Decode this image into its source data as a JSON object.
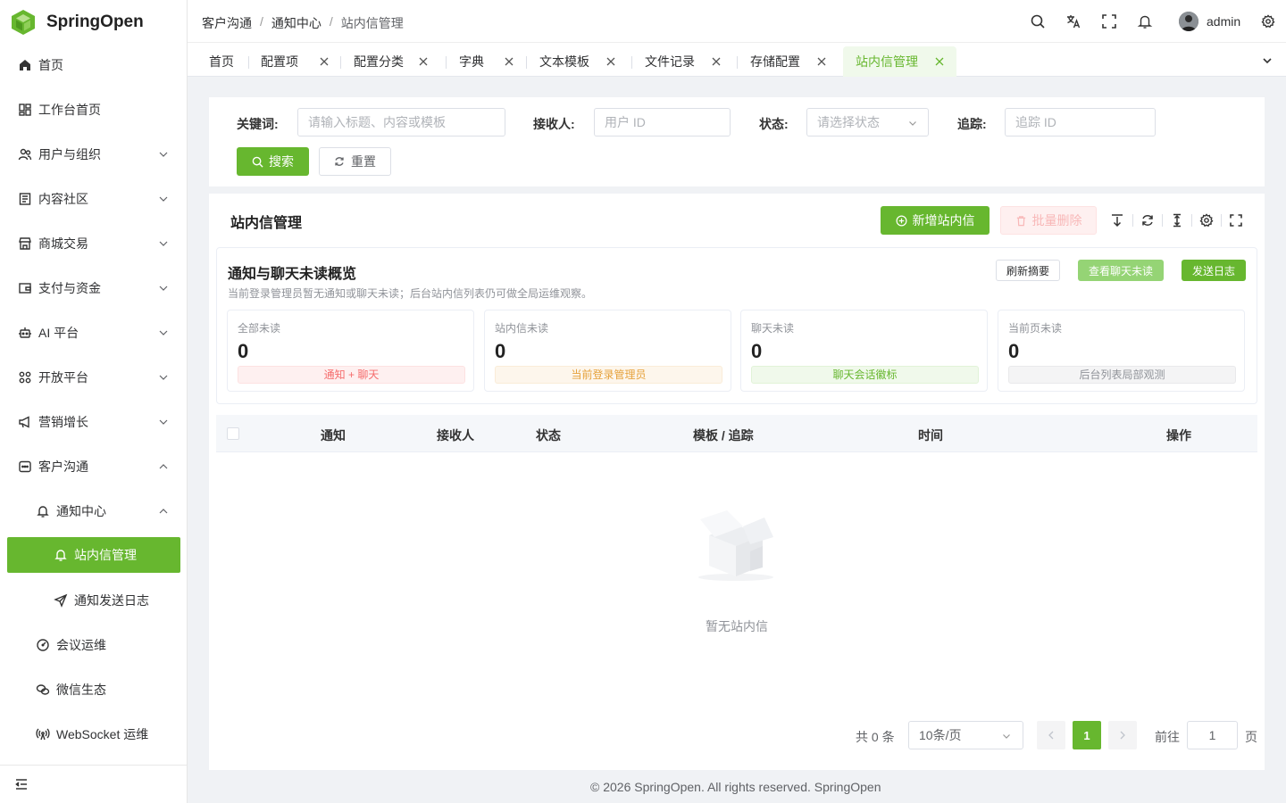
{
  "app": {
    "name": "SpringOpen"
  },
  "sidebar": {
    "items": [
      {
        "label": "首页"
      },
      {
        "label": "工作台首页"
      },
      {
        "label": "用户与组织"
      },
      {
        "label": "内容社区"
      },
      {
        "label": "商城交易"
      },
      {
        "label": "支付与资金"
      },
      {
        "label": "AI 平台"
      },
      {
        "label": "开放平台"
      },
      {
        "label": "营销增长"
      },
      {
        "label": "客户沟通"
      },
      {
        "label": "通知中心"
      },
      {
        "label": "站内信管理"
      },
      {
        "label": "通知发送日志"
      },
      {
        "label": "会议运维"
      },
      {
        "label": "微信生态"
      },
      {
        "label": "WebSocket 运维"
      }
    ]
  },
  "breadcrumb": [
    "客户沟通",
    "通知中心",
    "站内信管理"
  ],
  "header": {
    "username": "admin"
  },
  "tabs": [
    "首页",
    "配置项",
    "配置分类",
    "字典",
    "文本模板",
    "文件记录",
    "存储配置",
    "站内信管理"
  ],
  "search": {
    "keyword_label": "关键词:",
    "keyword_placeholder": "请输入标题、内容或模板",
    "receiver_label": "接收人:",
    "receiver_placeholder": "用户 ID",
    "status_label": "状态:",
    "status_placeholder": "请选择状态",
    "trace_label": "追踪:",
    "trace_placeholder": "追踪 ID",
    "search_button": "搜索",
    "reset_button": "重置"
  },
  "main": {
    "title": "站内信管理",
    "add_button": "新增站内信",
    "batch_delete_button": "批量删除"
  },
  "overview": {
    "title": "通知与聊天未读概览",
    "subtitle": "当前登录管理员暂无通知或聊天未读；后台站内信列表仍可做全局运维观察。",
    "refresh_button": "刷新摘要",
    "view_chat_button": "查看聊天未读",
    "send_log_button": "发送日志",
    "stats": [
      {
        "label": "全部未读",
        "value": "0",
        "tag": "通知 + 聊天"
      },
      {
        "label": "站内信未读",
        "value": "0",
        "tag": "当前登录管理员"
      },
      {
        "label": "聊天未读",
        "value": "0",
        "tag": "聊天会话徽标"
      },
      {
        "label": "当前页未读",
        "value": "0",
        "tag": "后台列表局部观测"
      }
    ]
  },
  "table": {
    "columns": [
      "通知",
      "接收人",
      "状态",
      "模板 / 追踪",
      "时间",
      "操作"
    ],
    "empty_text": "暂无站内信"
  },
  "pagination": {
    "total": "共 0 条",
    "page_size": "10条/页",
    "current_page": "1",
    "goto_label": "前往",
    "goto_value": "1",
    "page_suffix": "页"
  },
  "footer": {
    "text": "© 2026 SpringOpen. All rights reserved. SpringOpen"
  },
  "colors": {
    "primary": "#67b72f",
    "danger": "#f56c6c",
    "warning": "#e6a23c"
  }
}
